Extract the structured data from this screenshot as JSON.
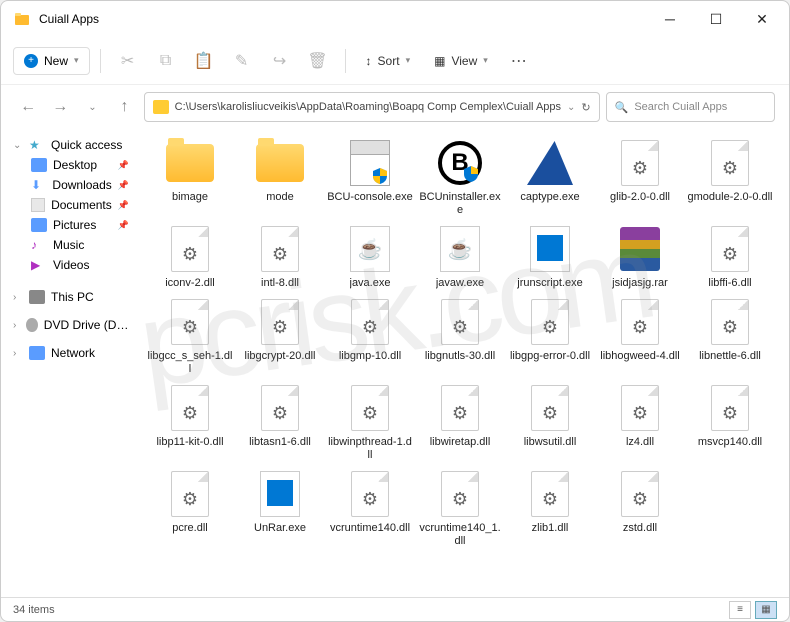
{
  "window": {
    "title": "Cuiall Apps"
  },
  "toolbar": {
    "new_label": "New",
    "sort_label": "Sort",
    "view_label": "View"
  },
  "address": {
    "path": "C:\\Users\\karolisliucveikis\\AppData\\Roaming\\Boapq Comp Cemplex\\Cuiall Apps"
  },
  "search": {
    "placeholder": "Search Cuiall Apps"
  },
  "sidebar": {
    "quick_access": "Quick access",
    "items": [
      {
        "label": "Desktop"
      },
      {
        "label": "Downloads"
      },
      {
        "label": "Documents"
      },
      {
        "label": "Pictures"
      },
      {
        "label": "Music"
      },
      {
        "label": "Videos"
      }
    ],
    "this_pc": "This PC",
    "dvd": "DVD Drive (D:) CCCC",
    "network": "Network"
  },
  "files": [
    {
      "name": "bimage",
      "type": "folder"
    },
    {
      "name": "mode",
      "type": "folder"
    },
    {
      "name": "BCU-console.exe",
      "type": "exe-shield"
    },
    {
      "name": "BCUninstaller.exe",
      "type": "b-icon"
    },
    {
      "name": "captype.exe",
      "type": "shark"
    },
    {
      "name": "glib-2.0-0.dll",
      "type": "dll"
    },
    {
      "name": "gmodule-2.0-0.dll",
      "type": "dll"
    },
    {
      "name": "iconv-2.dll",
      "type": "dll"
    },
    {
      "name": "intl-8.dll",
      "type": "dll"
    },
    {
      "name": "java.exe",
      "type": "java"
    },
    {
      "name": "javaw.exe",
      "type": "java"
    },
    {
      "name": "jrunscript.exe",
      "type": "jrun"
    },
    {
      "name": "jsidjasjg.rar",
      "type": "rar"
    },
    {
      "name": "libffi-6.dll",
      "type": "dll"
    },
    {
      "name": "libgcc_s_seh-1.dll",
      "type": "dll"
    },
    {
      "name": "libgcrypt-20.dll",
      "type": "dll"
    },
    {
      "name": "libgmp-10.dll",
      "type": "dll"
    },
    {
      "name": "libgnutls-30.dll",
      "type": "dll"
    },
    {
      "name": "libgpg-error-0.dll",
      "type": "dll"
    },
    {
      "name": "libhogweed-4.dll",
      "type": "dll"
    },
    {
      "name": "libnettle-6.dll",
      "type": "dll"
    },
    {
      "name": "libp11-kit-0.dll",
      "type": "dll"
    },
    {
      "name": "libtasn1-6.dll",
      "type": "dll"
    },
    {
      "name": "libwinpthread-1.dll",
      "type": "dll"
    },
    {
      "name": "libwiretap.dll",
      "type": "dll"
    },
    {
      "name": "libwsutil.dll",
      "type": "dll"
    },
    {
      "name": "lz4.dll",
      "type": "dll"
    },
    {
      "name": "msvcp140.dll",
      "type": "dll"
    },
    {
      "name": "pcre.dll",
      "type": "dll"
    },
    {
      "name": "UnRar.exe",
      "type": "jrun"
    },
    {
      "name": "vcruntime140.dll",
      "type": "dll"
    },
    {
      "name": "vcruntime140_1.dll",
      "type": "dll"
    },
    {
      "name": "zlib1.dll",
      "type": "dll"
    },
    {
      "name": "zstd.dll",
      "type": "dll"
    }
  ],
  "status": {
    "count": "34 items"
  }
}
